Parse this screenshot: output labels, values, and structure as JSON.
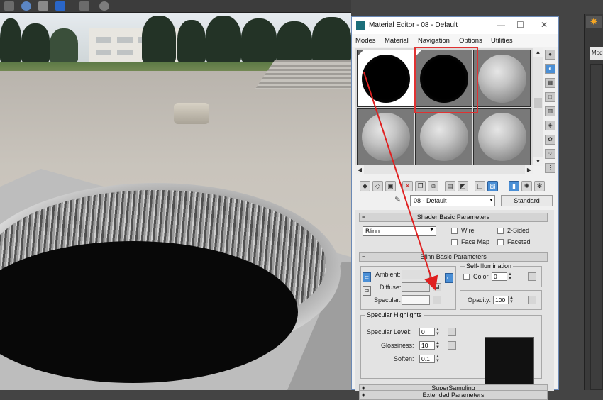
{
  "window": {
    "title": "Material Editor - 08 - Default",
    "minimize": "—",
    "maximize": "☐",
    "close": "✕"
  },
  "menu": {
    "items": [
      "Modes",
      "Material",
      "Navigation",
      "Options",
      "Utilities"
    ]
  },
  "slots": {
    "highlighted_slot": 2,
    "arrows": {
      "up": "▲",
      "down": "▼",
      "left": "◀",
      "right": "▶"
    }
  },
  "material": {
    "name": "08 - Default",
    "type": "Standard",
    "name_arrow": "▼"
  },
  "rollouts": {
    "shader_basic": {
      "title": "Shader Basic Parameters",
      "toggle": "−",
      "shader": "Blinn",
      "wire": "Wire",
      "two_sided": "2-Sided",
      "face_map": "Face Map",
      "faceted": "Faceted"
    },
    "blinn_basic": {
      "title": "Blinn Basic Parameters",
      "toggle": "−",
      "self_illum_title": "Self-Illumination",
      "color_label": "Color",
      "color_value": "0",
      "ambient": "Ambient:",
      "diffuse": "Diffuse:",
      "specular": "Specular:",
      "map_button": "M",
      "opacity_label": "Opacity:",
      "opacity_value": "100"
    },
    "specular_highlights": {
      "title": "Specular Highlights",
      "level_label": "Specular Level:",
      "level_value": "0",
      "gloss_label": "Glossiness:",
      "gloss_value": "10",
      "soften_label": "Soften:",
      "soften_value": "0.1"
    },
    "extended": {
      "title": "Extended Parameters",
      "toggle": "+"
    },
    "supersampling": {
      "title": "SuperSampling",
      "toggle": "+"
    }
  },
  "command_panel": {
    "modifier_label": "Modc"
  },
  "colors": {
    "highlight_red": "#e03232",
    "active_blue": "#4a8fd6",
    "annotation_arrow": "#e02020"
  },
  "icons": {
    "swatch_picker": "eyedropper-icon",
    "title_app": "3dsmax-icon"
  }
}
